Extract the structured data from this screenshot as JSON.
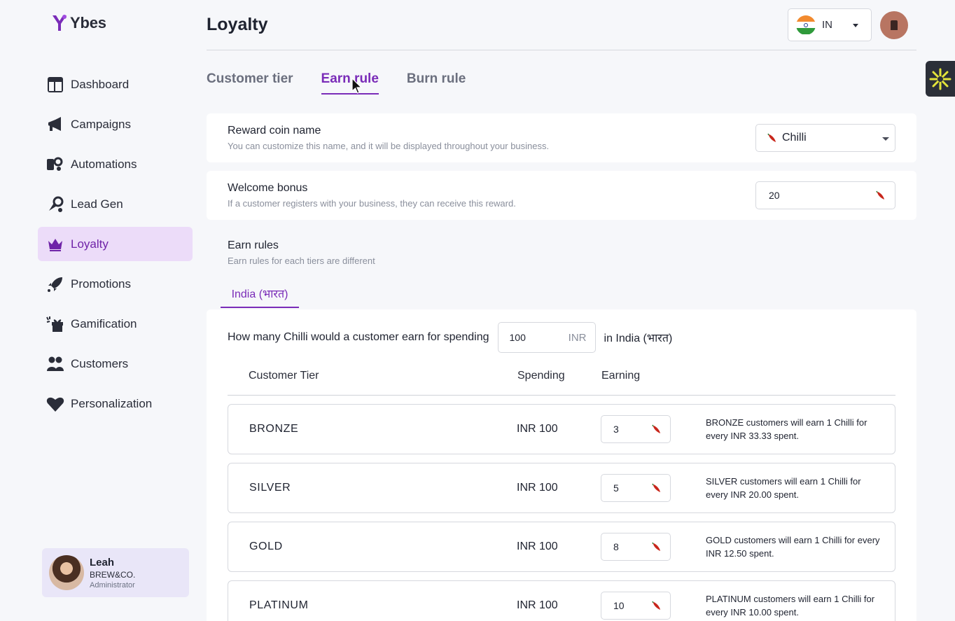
{
  "brand": {
    "name": "Ybes"
  },
  "sidebar": {
    "items": [
      {
        "label": "Dashboard",
        "icon": "dashboard-icon"
      },
      {
        "label": "Campaigns",
        "icon": "megaphone-icon"
      },
      {
        "label": "Automations",
        "icon": "automation-icon"
      },
      {
        "label": "Lead Gen",
        "icon": "magnet-icon"
      },
      {
        "label": "Loyalty",
        "icon": "crown-icon",
        "active": true
      },
      {
        "label": "Promotions",
        "icon": "rocket-icon"
      },
      {
        "label": "Gamification",
        "icon": "gift-icon"
      },
      {
        "label": "Customers",
        "icon": "users-icon"
      },
      {
        "label": "Personalization",
        "icon": "heart-icon"
      }
    ],
    "user": {
      "name": "Leah",
      "org": "BREW&CO.",
      "role": "Administrator"
    }
  },
  "header": {
    "title": "Loyalty",
    "country_code": "IN"
  },
  "tabs": [
    {
      "label": "Customer tier",
      "active": false
    },
    {
      "label": "Earn rule",
      "active": true
    },
    {
      "label": "Burn rule",
      "active": false
    }
  ],
  "reward_coin": {
    "title": "Reward coin name",
    "description": "You can customize this name, and it will be displayed throughout your business.",
    "value": "Chilli"
  },
  "welcome_bonus": {
    "title": "Welcome bonus",
    "description": "If a customer registers with your business, they can receive this reward.",
    "value": "20"
  },
  "earn_rules": {
    "title": "Earn rules",
    "description": "Earn rules for each tiers are different",
    "region_tab": "India (भारत)",
    "question_prefix": "How many Chilli would a customer earn for spending",
    "spend_amount": "100",
    "spend_unit": "INR",
    "question_suffix": "in India (भारत)",
    "columns": {
      "tier": "Customer Tier",
      "spending": "Spending",
      "earning": "Earning"
    },
    "rows": [
      {
        "tier": "BRONZE",
        "spending": "INR 100",
        "earning": "3",
        "note": "BRONZE customers will earn 1 Chilli for every INR 33.33 spent."
      },
      {
        "tier": "SILVER",
        "spending": "INR 100",
        "earning": "5",
        "note": "SILVER customers will earn 1 Chilli for every INR 20.00 spent."
      },
      {
        "tier": "GOLD",
        "spending": "INR 100",
        "earning": "8",
        "note": "GOLD customers will earn 1 Chilli for every INR 12.50 spent."
      },
      {
        "tier": "PLATINUM",
        "spending": "INR 100",
        "earning": "10",
        "note": "PLATINUM customers will earn 1 Chilli for every INR 10.00 spent."
      }
    ]
  },
  "colors": {
    "accent": "#7a2cb8",
    "active_bg": "#ecdcf9",
    "chili": "#c8261b"
  }
}
